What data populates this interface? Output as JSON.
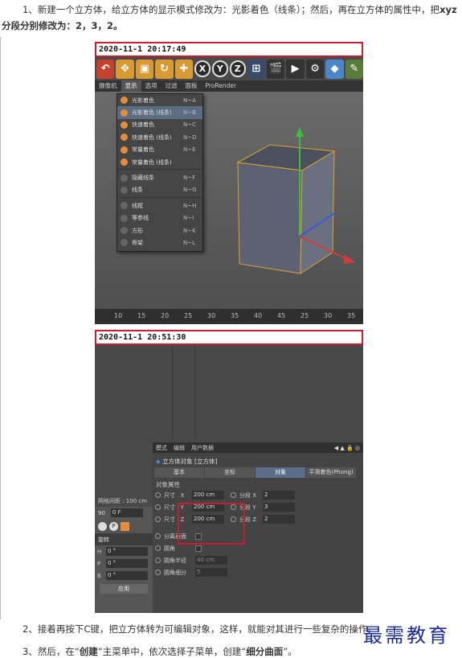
{
  "text": {
    "p1_main": "1、新建一个立方体，给立方体的显示模式修改为：光影着色（线条）；然后，再在立方体的属性中，把",
    "p1_bold_xyz": "xyz",
    "p1_line2": "分段分别修改为：2，3，2。",
    "p2": "2、接着再按下C键，把立方体转为可编辑对象，这样，就能对其进行一些复杂的操作。",
    "p3_a": "3、然后，在“",
    "p3_create": "创建",
    "p3_b": "”主菜单中，依次选择子菜单，创建“",
    "p3_subdiv": "细分曲面",
    "p3_c": "”。",
    "watermark": "最需教育"
  },
  "shot1": {
    "timestamp": "2020-11-1 20:17:49",
    "menubar": [
      "摄像机",
      "显示",
      "选项",
      "过滤",
      "面板",
      "ProRender"
    ],
    "display_menu": [
      {
        "label": "光影着色",
        "key": "N~A",
        "icon": "sphere-icon"
      },
      {
        "label": "光影着色 (线条)",
        "key": "N~B",
        "icon": "sphere-icon",
        "highlighted": true
      },
      {
        "label": "快速着色",
        "key": "N~C",
        "icon": "sphere-icon"
      },
      {
        "label": "快速着色 (线条)",
        "key": "N~D",
        "icon": "sphere-icon"
      },
      {
        "label": "常量着色",
        "key": "N~E",
        "icon": "sphere-icon"
      },
      {
        "label": "常量着色 (线条)",
        "key": "",
        "icon": "sphere-icon"
      },
      {
        "label": "隐藏线条",
        "key": "N~F",
        "icon": "grey-icon"
      },
      {
        "label": "线条",
        "key": "N~G",
        "icon": "grey-icon"
      },
      {
        "label": "线框",
        "key": "N~H",
        "icon": "grey-icon"
      },
      {
        "label": "等参线",
        "key": "N~I",
        "icon": "grey-icon"
      },
      {
        "label": "方形",
        "key": "N~K",
        "icon": "grey-icon"
      },
      {
        "label": "骨架",
        "key": "N~L",
        "icon": "grey-icon"
      }
    ],
    "ruler": [
      "10",
      "15",
      "20",
      "25",
      "30",
      "35",
      "40",
      "45",
      "25",
      "30",
      "35"
    ]
  },
  "shot2": {
    "timestamp": "2020-11-1 20:51:30",
    "grid_label": "网格间距 : 100 cm",
    "frame_value": "90",
    "frame_field": "0 F",
    "rotate_label": "旋转",
    "rot_rows": [
      {
        "axis": "H",
        "value": "0 °"
      },
      {
        "axis": "P",
        "value": "0 °"
      },
      {
        "axis": "B",
        "value": "0 °"
      }
    ],
    "apply": "应用",
    "attr_menu": [
      "模式",
      "编辑",
      "用户数据"
    ],
    "object_title": "立方体对象 [立方体]",
    "tabs": [
      "基本",
      "坐标",
      "对象",
      "平滑着色(Phong)"
    ],
    "active_tab": "对象",
    "section": "对象属性",
    "size_rows": [
      {
        "label": "尺寸 . X",
        "value": "200 cm",
        "seg_label": "分段 X",
        "seg_value": "2"
      },
      {
        "label": "尺寸 . Y",
        "value": "200 cm",
        "seg_label": "分段 Y",
        "seg_value": "3"
      },
      {
        "label": "尺寸 . Z",
        "value": "200 cm",
        "seg_label": "分段 Z",
        "seg_value": "2"
      }
    ],
    "extra_rows": [
      {
        "label": "分离表面",
        "value": ""
      },
      {
        "label": "圆角",
        "value": ""
      },
      {
        "label": "圆角半径",
        "value": "40 cm"
      },
      {
        "label": "圆角细分",
        "value": "5"
      }
    ]
  }
}
